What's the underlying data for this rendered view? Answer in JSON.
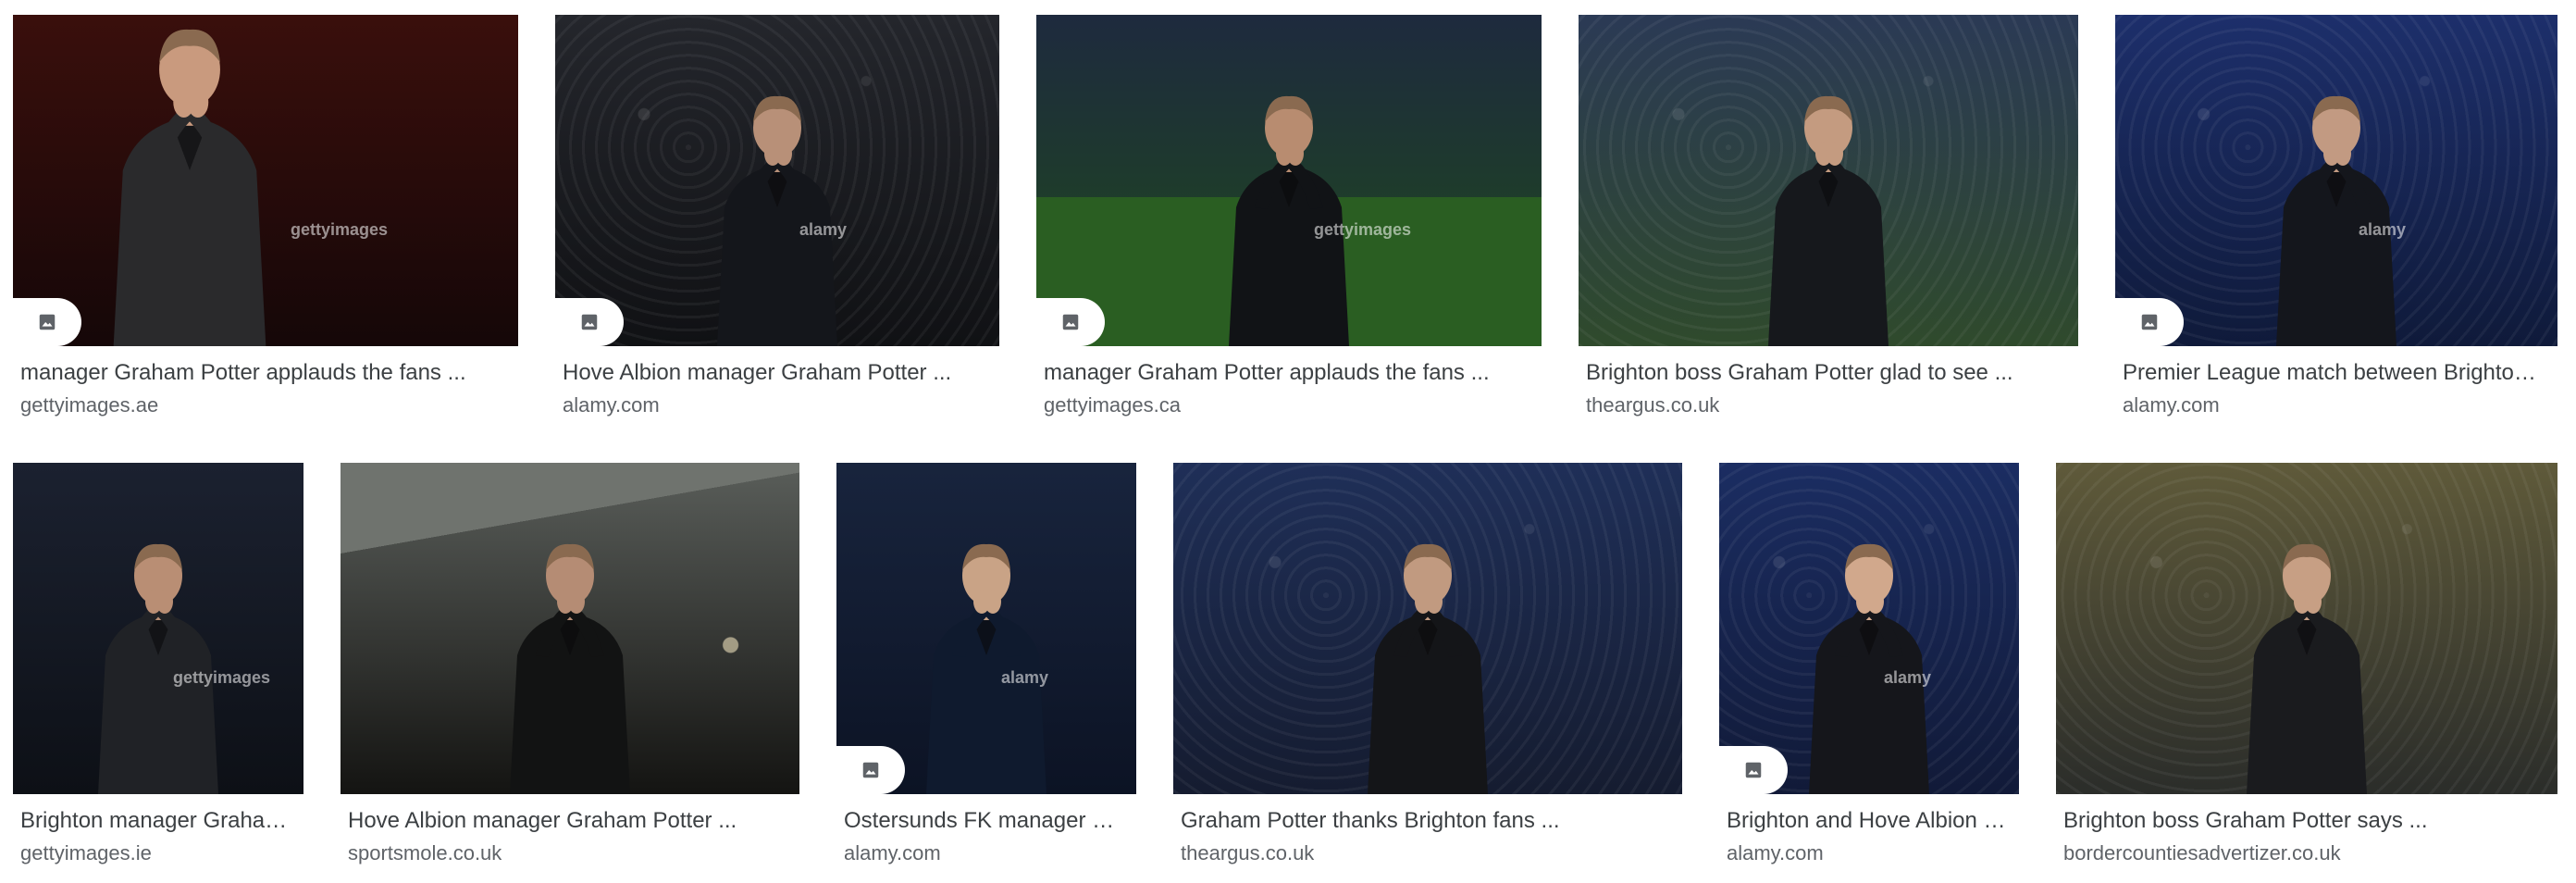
{
  "results": [
    {
      "title": "manager Graham Potter applauds the fans ...",
      "source": "gettyimages.ae",
      "watermark": "gettyimages",
      "icon": "image-icon",
      "scene": "closeup",
      "colors": {
        "bg_top": "#3a0f0c",
        "bg_bottom": "#150708",
        "jacket": "#2a2a2c",
        "skin": "#c99a7e"
      }
    },
    {
      "title": "Hove Albion manager Graham Potter ...",
      "source": "alamy.com",
      "watermark": "alamy",
      "icon": "image-icon",
      "scene": "crowd",
      "colors": {
        "bg_top": "#24262c",
        "bg_bottom": "#101114",
        "jacket": "#14161b",
        "skin": "#b89078"
      }
    },
    {
      "title": "manager Graham Potter applauds the fans ...",
      "source": "gettyimages.ca",
      "watermark": "gettyimages",
      "icon": "image-icon",
      "scene": "pitch",
      "colors": {
        "bg_top": "#1e2a3e",
        "bg_bottom": "#1f4a1c",
        "jacket": "#111316",
        "skin": "#b88c70"
      }
    },
    {
      "title": "Brighton boss Graham Potter glad to see ...",
      "source": "theargus.co.uk",
      "watermark": "",
      "icon": "",
      "scene": "crowd-wide",
      "colors": {
        "bg_top": "#2b3a55",
        "bg_bottom": "#2f4a2c",
        "jacket": "#16181c",
        "skin": "#c49b80"
      }
    },
    {
      "title": "Premier League match between Brighto…",
      "source": "alamy.com",
      "watermark": "alamy",
      "icon": "image-icon",
      "scene": "stands-blue",
      "colors": {
        "bg_top": "#1d2f6b",
        "bg_bottom": "#0f1a3a",
        "jacket": "#14161c",
        "skin": "#c29a82"
      }
    },
    {
      "title": "Brighton manager Graha…",
      "source": "gettyimages.ie",
      "watermark": "gettyimages",
      "icon": "",
      "scene": "night",
      "colors": {
        "bg_top": "#1b2130",
        "bg_bottom": "#0d1016",
        "jacket": "#202226",
        "skin": "#b98e74"
      }
    },
    {
      "title": "Hove Albion manager Graham Potter ...",
      "source": "sportsmole.co.uk",
      "watermark": "",
      "icon": "",
      "scene": "stadium-roof",
      "colors": {
        "bg_top": "#5a5e5a",
        "bg_bottom": "#141412",
        "jacket": "#121313",
        "skin": "#b58c74"
      }
    },
    {
      "title": "Ostersunds FK manager G…",
      "source": "alamy.com",
      "watermark": "alamy",
      "icon": "image-icon",
      "scene": "dark-navy",
      "colors": {
        "bg_top": "#18243d",
        "bg_bottom": "#0c1324",
        "jacket": "#0f1a2e",
        "skin": "#c9a386"
      }
    },
    {
      "title": "Graham Potter thanks Brighton fans ...",
      "source": "theargus.co.uk",
      "watermark": "",
      "icon": "",
      "scene": "crowd-blue",
      "colors": {
        "bg_top": "#1f2f58",
        "bg_bottom": "#151c30",
        "jacket": "#141518",
        "skin": "#c19a80"
      }
    },
    {
      "title": "Brighton and Hove Albion …",
      "source": "alamy.com",
      "watermark": "alamy",
      "icon": "image-icon",
      "scene": "stands-blue",
      "colors": {
        "bg_top": "#1b2d62",
        "bg_bottom": "#111a38",
        "jacket": "#15161b",
        "skin": "#d1a88c"
      }
    },
    {
      "title": "Brighton boss Graham Potter says ...",
      "source": "bordercountiesadvertizer.co.uk",
      "watermark": "",
      "icon": "",
      "scene": "stands-yellow",
      "colors": {
        "bg_top": "#5f5a3a",
        "bg_bottom": "#2b2d2a",
        "jacket": "#1a1b1e",
        "skin": "#c79f84"
      }
    }
  ]
}
